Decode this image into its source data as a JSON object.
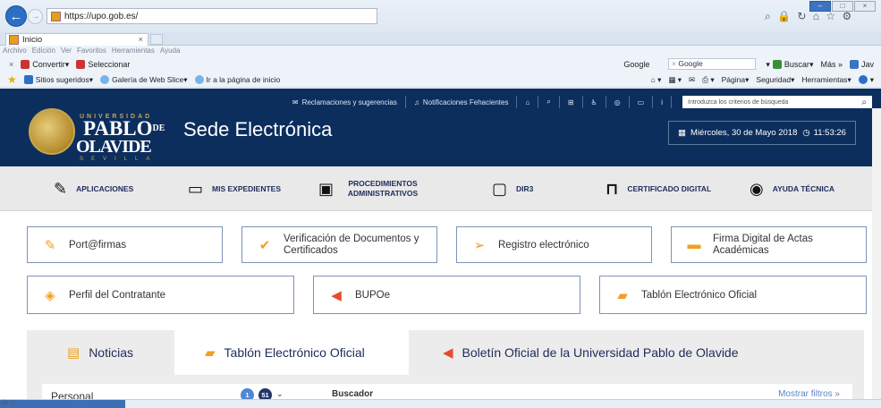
{
  "browser": {
    "url": "https://upo.gob.es/",
    "tab_title": "Inicio",
    "tab_close": "×",
    "menu": [
      "Archivo",
      "Edición",
      "Ver",
      "Favoritos",
      "Herramientas",
      "Ayuda"
    ],
    "command_bar": {
      "close": "×",
      "convertir": "Convertir",
      "seleccionar": "Seleccionar",
      "search_engine": "Google",
      "buscar": "Buscar",
      "mas": "Más »",
      "java": "Jav"
    },
    "favorites_bar": {
      "sitios": "Sitios sugeridos",
      "galeria": "Galería de Web Slice",
      "ir_inicio": "Ir a la página de inicio",
      "pagina": "Página",
      "seguridad": "Seguridad",
      "herramientas": "Herramientas"
    },
    "status_text": "de U..."
  },
  "site": {
    "utility": {
      "reclamaciones": "Reclamaciones y sugerencias",
      "notificaciones": "Notificaciones Fehacientes",
      "search_placeholder": "Introduzca los criterios de búsqueda"
    },
    "logo": {
      "universidad": "UNIVERSIDAD",
      "pablo": "PABLO",
      "de": "DE",
      "olavide": "OLAVIDE",
      "sevilla": "SEVILLA"
    },
    "title": "Sede Electrónica",
    "datetime": "Miércoles, 30 de Mayo 2018",
    "time": "11:53:26",
    "main_menu": [
      {
        "label": "APLICACIONES",
        "icon": "magic-wand-icon"
      },
      {
        "label": "MIS EXPEDIENTES",
        "icon": "laptop-icon"
      },
      {
        "label": "PROCEDIMIENTOS ADMINISTRATIVOS",
        "icon": "briefcase-icon"
      },
      {
        "label": "DIR3",
        "icon": "folder-icon"
      },
      {
        "label": "CERTIFICADO DIGITAL",
        "icon": "bookmark-icon"
      },
      {
        "label": "AYUDA TÉCNICA",
        "icon": "lifebuoy-icon"
      }
    ],
    "cards": [
      {
        "label": "Port@firmas",
        "icon": "pencil-icon"
      },
      {
        "label": "Verificación de Documentos y Certificados",
        "icon": "check-icon"
      },
      {
        "label": "Registro electrónico",
        "icon": "send-icon"
      },
      {
        "label": "Firma Digital de Actas Académicas",
        "icon": "credit-card-icon"
      },
      {
        "label": "Perfil del Contratante",
        "icon": "box-icon"
      },
      {
        "label": "BUPOe",
        "icon": "megaphone-icon"
      },
      {
        "label": "Tablón Electrónico Oficial",
        "icon": "book-icon"
      }
    ],
    "section_tabs": [
      {
        "label": "Noticias",
        "icon": "newspaper-icon"
      },
      {
        "label": "Tablón Electrónico Oficial",
        "icon": "book-icon"
      },
      {
        "label": "Boletín Oficial de la Universidad Pablo de Olavide",
        "icon": "megaphone-icon"
      }
    ],
    "personal": {
      "label": "Personal",
      "badge1": "1",
      "badge2": "51"
    },
    "buscador": {
      "label": "Buscador",
      "show_filters": "Mostrar filtros »"
    }
  }
}
